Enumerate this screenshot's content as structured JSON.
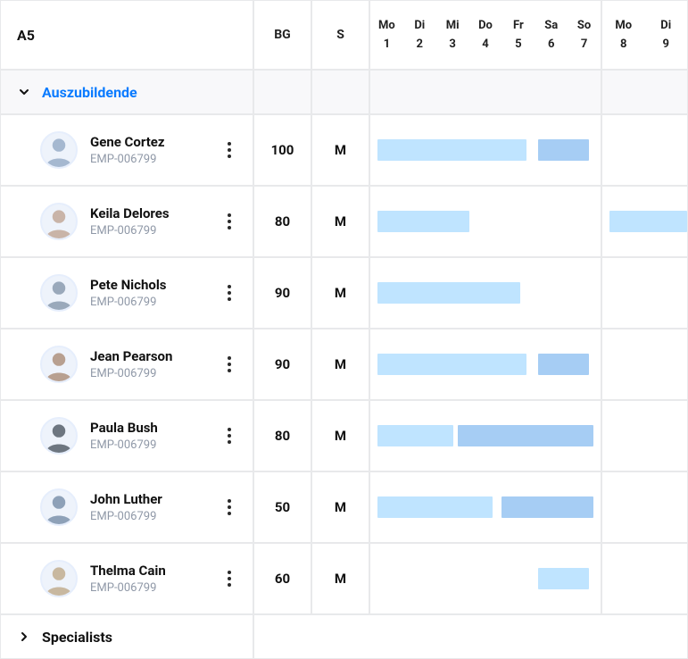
{
  "chart_data": {
    "type": "table",
    "title": "A5",
    "columns": [
      "BG",
      "S"
    ],
    "week1_days": [
      [
        "Mo",
        1
      ],
      [
        "Di",
        2
      ],
      [
        "Mi",
        3
      ],
      [
        "Do",
        4
      ],
      [
        "Fr",
        5
      ],
      [
        "Sa",
        6
      ],
      [
        "So",
        7
      ]
    ],
    "week2_days": [
      [
        "Mo",
        8
      ],
      [
        "Di",
        9
      ]
    ],
    "groups": [
      {
        "name": "Auszubildende",
        "expanded": true,
        "rows": [
          {
            "name": "Gene Cortez",
            "id": "EMP-006799",
            "bg": 100,
            "s": "M",
            "bars": [
              {
                "start": 1,
                "end": 5,
                "shade": "light"
              },
              {
                "start": 6,
                "end": 7,
                "shade": "med"
              }
            ],
            "week2_bars": []
          },
          {
            "name": "Keila Delores",
            "id": "EMP-006799",
            "bg": 80,
            "s": "M",
            "bars": [
              {
                "start": 1,
                "end": 3,
                "shade": "light"
              }
            ],
            "week2_bars": [
              {
                "start": 8,
                "end": 9,
                "shade": "light"
              }
            ]
          },
          {
            "name": "Pete Nichols",
            "id": "EMP-006799",
            "bg": 90,
            "s": "M",
            "bars": [
              {
                "start": 1,
                "end": 5,
                "shade": "light"
              }
            ],
            "week2_bars": []
          },
          {
            "name": "Jean Pearson",
            "id": "EMP-006799",
            "bg": 90,
            "s": "M",
            "bars": [
              {
                "start": 1,
                "end": 5,
                "shade": "light"
              },
              {
                "start": 6,
                "end": 7,
                "shade": "med"
              }
            ],
            "week2_bars": []
          },
          {
            "name": "Paula Bush",
            "id": "EMP-006799",
            "bg": 80,
            "s": "M",
            "bars": [
              {
                "start": 1,
                "end": 3,
                "shade": "light"
              },
              {
                "start": 3,
                "end": 7,
                "shade": "med"
              }
            ],
            "week2_bars": []
          },
          {
            "name": "John Luther",
            "id": "EMP-006799",
            "bg": 50,
            "s": "M",
            "bars": [
              {
                "start": 1,
                "end": 4,
                "shade": "light"
              },
              {
                "start": 5,
                "end": 7,
                "shade": "med"
              }
            ],
            "week2_bars": []
          },
          {
            "name": "Thelma Cain",
            "id": "EMP-006799",
            "bg": 60,
            "s": "M",
            "bars": [
              {
                "start": 6,
                "end": 7,
                "shade": "light"
              }
            ],
            "week2_bars": []
          }
        ]
      },
      {
        "name": "Specialists",
        "expanded": false,
        "rows": []
      }
    ]
  },
  "header": {
    "corner": "A5",
    "col_bg": "BG",
    "col_s": "S",
    "week1": [
      {
        "dow": "Mo",
        "num": "1"
      },
      {
        "dow": "Di",
        "num": "2"
      },
      {
        "dow": "Mi",
        "num": "3"
      },
      {
        "dow": "Do",
        "num": "4"
      },
      {
        "dow": "Fr",
        "num": "5"
      },
      {
        "dow": "Sa",
        "num": "6"
      },
      {
        "dow": "So",
        "num": "7"
      }
    ],
    "week2": [
      {
        "dow": "Mo",
        "num": "8"
      },
      {
        "dow": "Di",
        "num": "9"
      }
    ]
  },
  "groups": {
    "g0": {
      "title": "Auszubildende"
    },
    "g1": {
      "title": "Specialists"
    }
  },
  "emp": {
    "r0": {
      "name": "Gene Cortez",
      "id": "EMP-006799",
      "bg": "100",
      "s": "M"
    },
    "r1": {
      "name": "Keila Delores",
      "id": "EMP-006799",
      "bg": "80",
      "s": "M"
    },
    "r2": {
      "name": "Pete Nichols",
      "id": "EMP-006799",
      "bg": "90",
      "s": "M"
    },
    "r3": {
      "name": "Jean Pearson",
      "id": "EMP-006799",
      "bg": "90",
      "s": "M"
    },
    "r4": {
      "name": "Paula Bush",
      "id": "EMP-006799",
      "bg": "80",
      "s": "M"
    },
    "r5": {
      "name": "John Luther",
      "id": "EMP-006799",
      "bg": "50",
      "s": "M"
    },
    "r6": {
      "name": "Thelma Cain",
      "id": "EMP-006799",
      "bg": "60",
      "s": "M"
    }
  },
  "colors": {
    "light": "#bfe4ff",
    "med": "#a6cdf4",
    "accent": "#0a7bff",
    "muted": "#8f98a7"
  }
}
